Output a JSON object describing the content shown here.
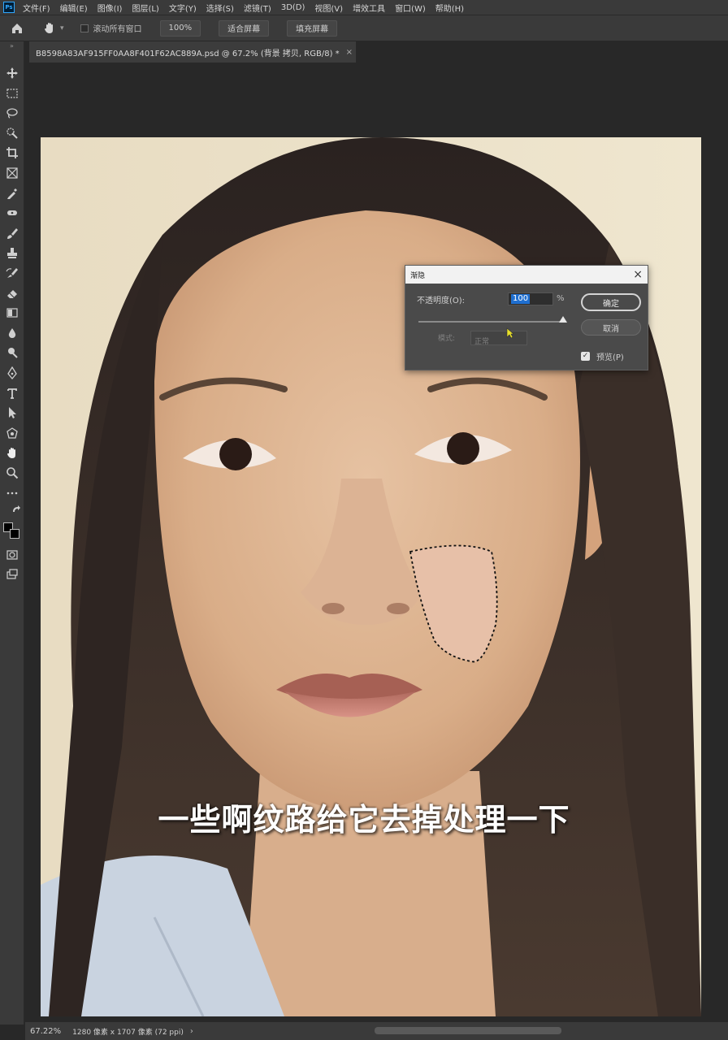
{
  "menubar": {
    "app_icon": "Ps",
    "items": [
      "文件(F)",
      "编辑(E)",
      "图像(I)",
      "图层(L)",
      "文字(Y)",
      "选择(S)",
      "滤镜(T)",
      "3D(D)",
      "视图(V)",
      "增效工具",
      "窗口(W)",
      "帮助(H)"
    ]
  },
  "options": {
    "scroll_all_label": "滚动所有窗口",
    "zoom_button": "100%",
    "fit_screen_button": "适合屏幕",
    "fill_screen_button": "填充屏幕"
  },
  "document": {
    "tab_title": "B8598A83AF915FF0AA8F401F62AC889A.psd @ 67.2% (背景 拷贝, RGB/8) *",
    "close_glyph": "×"
  },
  "dialog": {
    "title": "渐隐",
    "opacity_label": "不透明度(O):",
    "opacity_value": "100",
    "opacity_unit": "%",
    "opacity_fraction": 1.0,
    "mode_label": "模式:",
    "mode_value": "正常",
    "ok_label": "确定",
    "cancel_label": "取消",
    "preview_label": "预览(P)",
    "preview_checked": true
  },
  "subtitle": "一些啊纹路给它去掉处理一下",
  "status": {
    "zoom": "67.22%",
    "dimensions": "1280 像素 x 1707 像素 (72 ppi)",
    "arrow": "›"
  },
  "colors": {
    "foreground": "#000000",
    "background": "#000000",
    "accent": "#1f6fd0",
    "selection_outline": "#000000"
  },
  "toolbar": {
    "tools": [
      "move-icon",
      "marquee-icon",
      "lasso-icon",
      "quick-select-icon",
      "crop-icon",
      "frame-icon",
      "eyedropper-icon",
      "healing-icon",
      "brush-icon",
      "stamp-icon",
      "history-brush-icon",
      "eraser-icon",
      "gradient-icon",
      "blur-icon",
      "dodge-icon",
      "pen-icon",
      "type-icon",
      "path-select-icon",
      "shape-icon",
      "hand-icon",
      "zoom-icon",
      "more-icon"
    ]
  }
}
